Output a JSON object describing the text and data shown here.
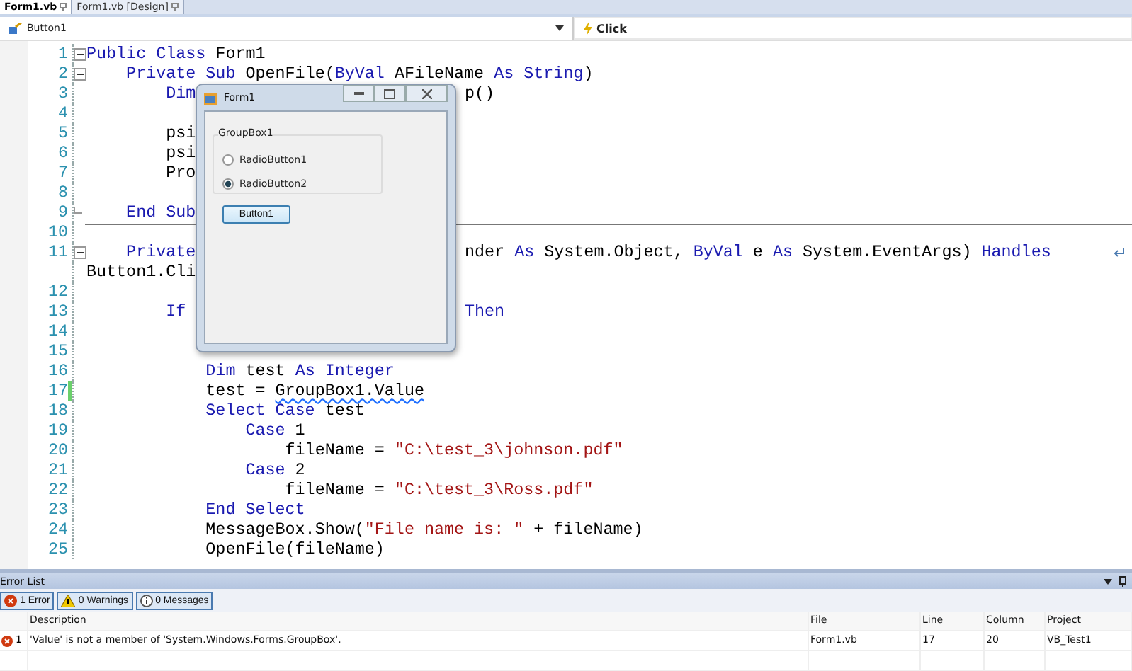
{
  "tabs": [
    {
      "label": "Form1.vb",
      "selected": true
    },
    {
      "label": "Form1.vb [Design]",
      "selected": false
    }
  ],
  "navigation": {
    "object": "Button1",
    "event": "Click"
  },
  "code_lines": [
    {
      "number": "1",
      "fold_start": true,
      "left": [
        {
          "kind": "keyword",
          "t": "Public Class"
        },
        {
          "kind": "text",
          "t": " Form1"
        }
      ]
    },
    {
      "number": "2",
      "fold_start": true,
      "left": [
        {
          "kind": "keyword",
          "t": "    Private Sub"
        },
        {
          "kind": "text",
          "t": " OpenFile("
        },
        {
          "kind": "keyword",
          "t": "ByVal"
        },
        {
          "kind": "text",
          "t": " AFileName "
        },
        {
          "kind": "keyword",
          "t": "As String"
        },
        {
          "kind": "text",
          "t": ")"
        }
      ]
    },
    {
      "number": "3",
      "left": [
        {
          "kind": "keyword",
          "t": "        Dim"
        }
      ],
      "right": [
        {
          "kind": "text",
          "t": "p()"
        }
      ]
    },
    {
      "number": "4"
    },
    {
      "number": "5",
      "left": [
        {
          "kind": "text",
          "t": "        psi"
        }
      ]
    },
    {
      "number": "6",
      "left": [
        {
          "kind": "text",
          "t": "        psi"
        }
      ]
    },
    {
      "number": "7",
      "left": [
        {
          "kind": "text",
          "t": "        Pro"
        }
      ]
    },
    {
      "number": "8"
    },
    {
      "number": "9",
      "fold_end": true,
      "left": [
        {
          "kind": "keyword",
          "t": "    End Sub"
        }
      ]
    },
    {
      "number": "10",
      "separator": true
    },
    {
      "number": "11",
      "fold_start": true,
      "wrapped": true,
      "left": [
        {
          "kind": "keyword",
          "t": "    Private"
        }
      ],
      "right": [
        {
          "kind": "text",
          "t": "nder "
        },
        {
          "kind": "keyword",
          "t": "As"
        },
        {
          "kind": "text",
          "t": " System.Object, "
        },
        {
          "kind": "keyword",
          "t": "ByVal"
        },
        {
          "kind": "text",
          "t": " e "
        },
        {
          "kind": "keyword",
          "t": "As"
        },
        {
          "kind": "text",
          "t": " System.EventArgs) "
        },
        {
          "kind": "keyword",
          "t": "Handles"
        }
      ]
    },
    {
      "left": [
        {
          "kind": "text",
          "t": "Button1.Cli"
        }
      ]
    },
    {
      "number": "12"
    },
    {
      "number": "13",
      "left": [
        {
          "kind": "keyword",
          "t": "        If"
        }
      ],
      "right": [
        {
          "kind": "keyword",
          "t": "Then"
        }
      ]
    },
    {
      "number": "14"
    },
    {
      "number": "15"
    },
    {
      "number": "16",
      "left": [
        {
          "kind": "keyword",
          "t": "            Dim"
        },
        {
          "kind": "text",
          "t": " test "
        },
        {
          "kind": "keyword",
          "t": "As Integer"
        }
      ]
    },
    {
      "number": "17",
      "changed": true,
      "left": [
        {
          "kind": "text",
          "t": "            test = "
        },
        {
          "kind": "error",
          "t": "GroupBox1.Value"
        }
      ]
    },
    {
      "number": "18",
      "left": [
        {
          "kind": "keyword",
          "t": "            Select Case"
        },
        {
          "kind": "text",
          "t": " test"
        }
      ]
    },
    {
      "number": "19",
      "left": [
        {
          "kind": "keyword",
          "t": "                Case"
        },
        {
          "kind": "text",
          "t": " 1"
        }
      ]
    },
    {
      "number": "20",
      "left": [
        {
          "kind": "text",
          "t": "                    fileName = "
        },
        {
          "kind": "string",
          "t": "\"C:\\test_3\\johnson.pdf\""
        }
      ]
    },
    {
      "number": "21",
      "left": [
        {
          "kind": "keyword",
          "t": "                Case"
        },
        {
          "kind": "text",
          "t": " 2"
        }
      ]
    },
    {
      "number": "22",
      "left": [
        {
          "kind": "text",
          "t": "                    fileName = "
        },
        {
          "kind": "string",
          "t": "\"C:\\test_3\\Ross.pdf\""
        }
      ]
    },
    {
      "number": "23",
      "left": [
        {
          "kind": "keyword",
          "t": "            End Select"
        }
      ]
    },
    {
      "number": "24",
      "left": [
        {
          "kind": "text",
          "t": "            MessageBox.Show("
        },
        {
          "kind": "string",
          "t": "\"File name is: \""
        },
        {
          "kind": "text",
          "t": " + fileName)"
        }
      ]
    },
    {
      "number": "25",
      "left": [
        {
          "kind": "text",
          "t": "            OpenFile(fileName)"
        }
      ]
    }
  ],
  "form_window": {
    "title": "Form1",
    "group_box": "GroupBox1",
    "radios": [
      {
        "label": "RadioButton1",
        "selected": false
      },
      {
        "label": "RadioButton2",
        "selected": true
      }
    ],
    "button": "Button1"
  },
  "error_list": {
    "title": "Error List",
    "filters": [
      {
        "kind": "error",
        "label": "1 Error",
        "selected": true
      },
      {
        "kind": "warning",
        "label": "0 Warnings",
        "selected": true
      },
      {
        "kind": "message",
        "label": "0 Messages",
        "selected": true
      }
    ],
    "columns": [
      "Description",
      "File",
      "Line",
      "Column",
      "Project"
    ],
    "rows": [
      {
        "index": "1",
        "description": "'Value' is not a member of 'System.Windows.Forms.GroupBox'.",
        "file": "Form1.vb",
        "line": "17",
        "column": "20",
        "project": "VB_Test1"
      }
    ]
  }
}
